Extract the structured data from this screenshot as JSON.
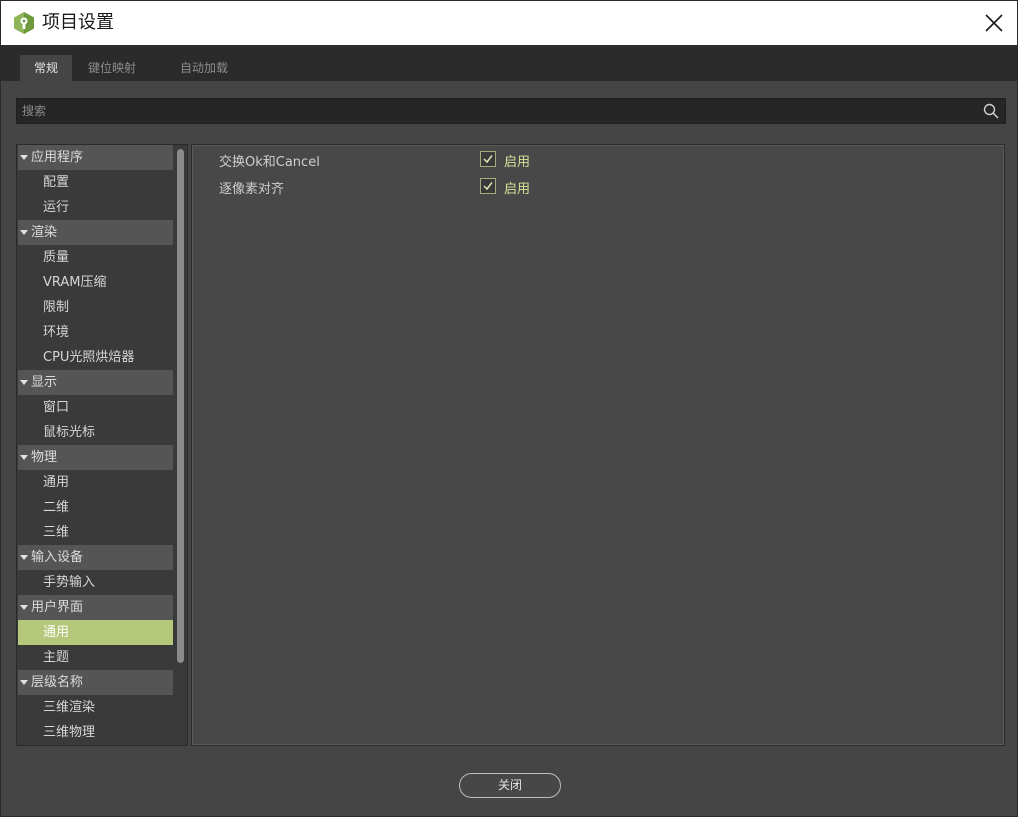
{
  "window": {
    "title": "项目设置",
    "close_icon": "close-icon",
    "app_icon": "godot-project-icon"
  },
  "tabs": [
    {
      "label": "常规",
      "active": true
    },
    {
      "label": "键位映射",
      "active": false
    },
    {
      "label": "自动加载",
      "active": false
    }
  ],
  "search": {
    "placeholder": "搜索",
    "value": ""
  },
  "tree": {
    "sections": [
      {
        "label": "应用程序",
        "items": [
          "配置",
          "运行"
        ]
      },
      {
        "label": "渲染",
        "items": [
          "质量",
          "VRAM压缩",
          "限制",
          "环境",
          "CPU光照烘焙器"
        ]
      },
      {
        "label": "显示",
        "items": [
          "窗口",
          "鼠标光标"
        ]
      },
      {
        "label": "物理",
        "items": [
          "通用",
          "二维",
          "三维"
        ]
      },
      {
        "label": "输入设备",
        "items": [
          "手势输入"
        ]
      },
      {
        "label": "用户界面",
        "items": [
          "通用",
          "主题"
        ]
      },
      {
        "label": "层级名称",
        "items": [
          "三维渲染",
          "三维物理"
        ]
      }
    ],
    "selected": "用户界面/通用"
  },
  "properties": [
    {
      "label": "交换Ok和Cancel",
      "checked": true,
      "value_label": "启用"
    },
    {
      "label": "逐像素对齐",
      "checked": true,
      "value_label": "启用"
    }
  ],
  "footer": {
    "close_label": "关闭"
  },
  "colors": {
    "accent": "#b4c77a",
    "enabled_text": "#d8e39a"
  }
}
